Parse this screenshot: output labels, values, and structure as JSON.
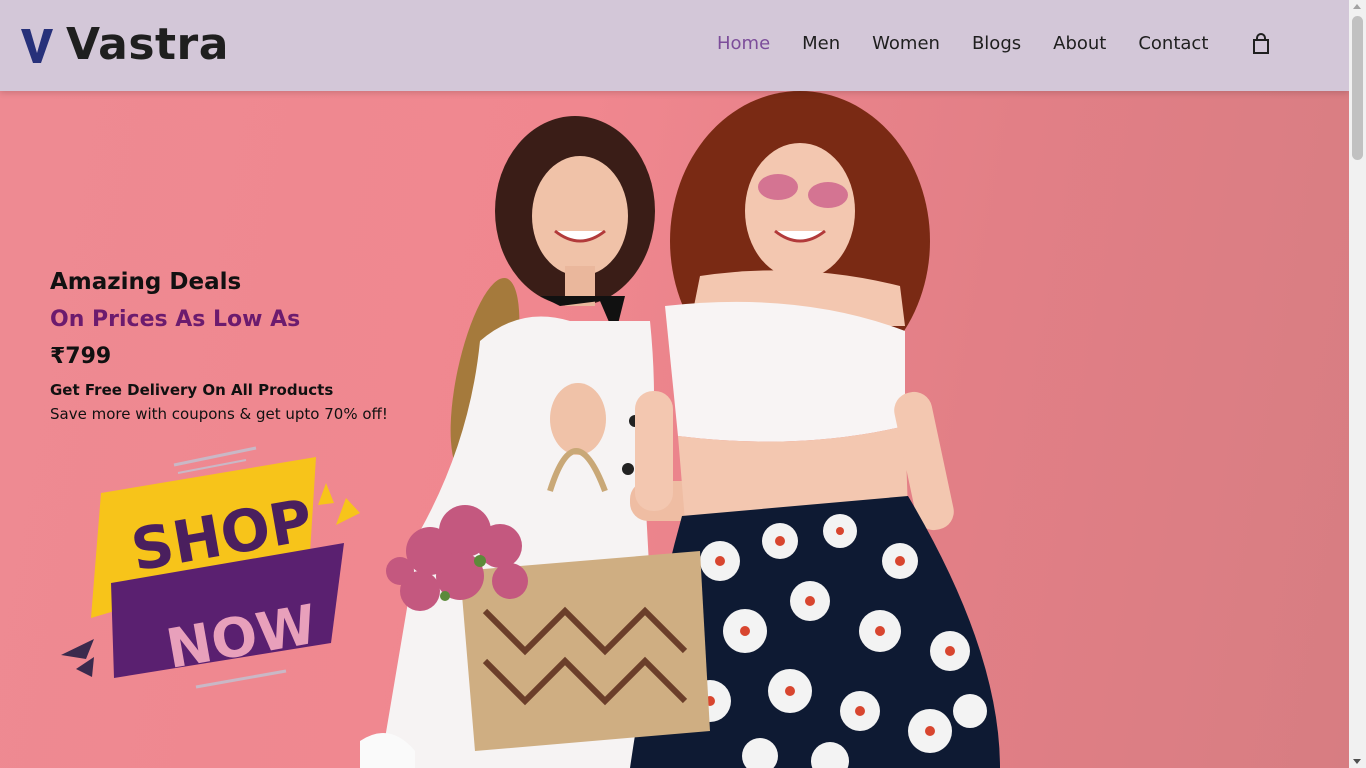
{
  "brand": {
    "name": "Vastra",
    "mark": "V",
    "mark_color": "#27317a"
  },
  "nav": {
    "items": [
      {
        "label": "Home",
        "active": true
      },
      {
        "label": "Men",
        "active": false
      },
      {
        "label": "Women",
        "active": false
      },
      {
        "label": "Blogs",
        "active": false
      },
      {
        "label": "About",
        "active": false
      },
      {
        "label": "Contact",
        "active": false
      }
    ],
    "active_color": "#7c4d9a",
    "cart_icon": "shopping-bag-icon"
  },
  "hero": {
    "heading": "Amazing Deals",
    "subheading": "On Prices As Low As",
    "price": "₹799",
    "delivery": "Get Free Delivery On All Products",
    "promo": "Save more with coupons & get upto 70% off!",
    "cta_top": "SHOP",
    "cta_bottom": "NOW",
    "background_color": "#ee8a92",
    "accent_color": "#6c1b6e",
    "cta_yellow": "#f7c41a",
    "cta_purple": "#5a2070"
  }
}
